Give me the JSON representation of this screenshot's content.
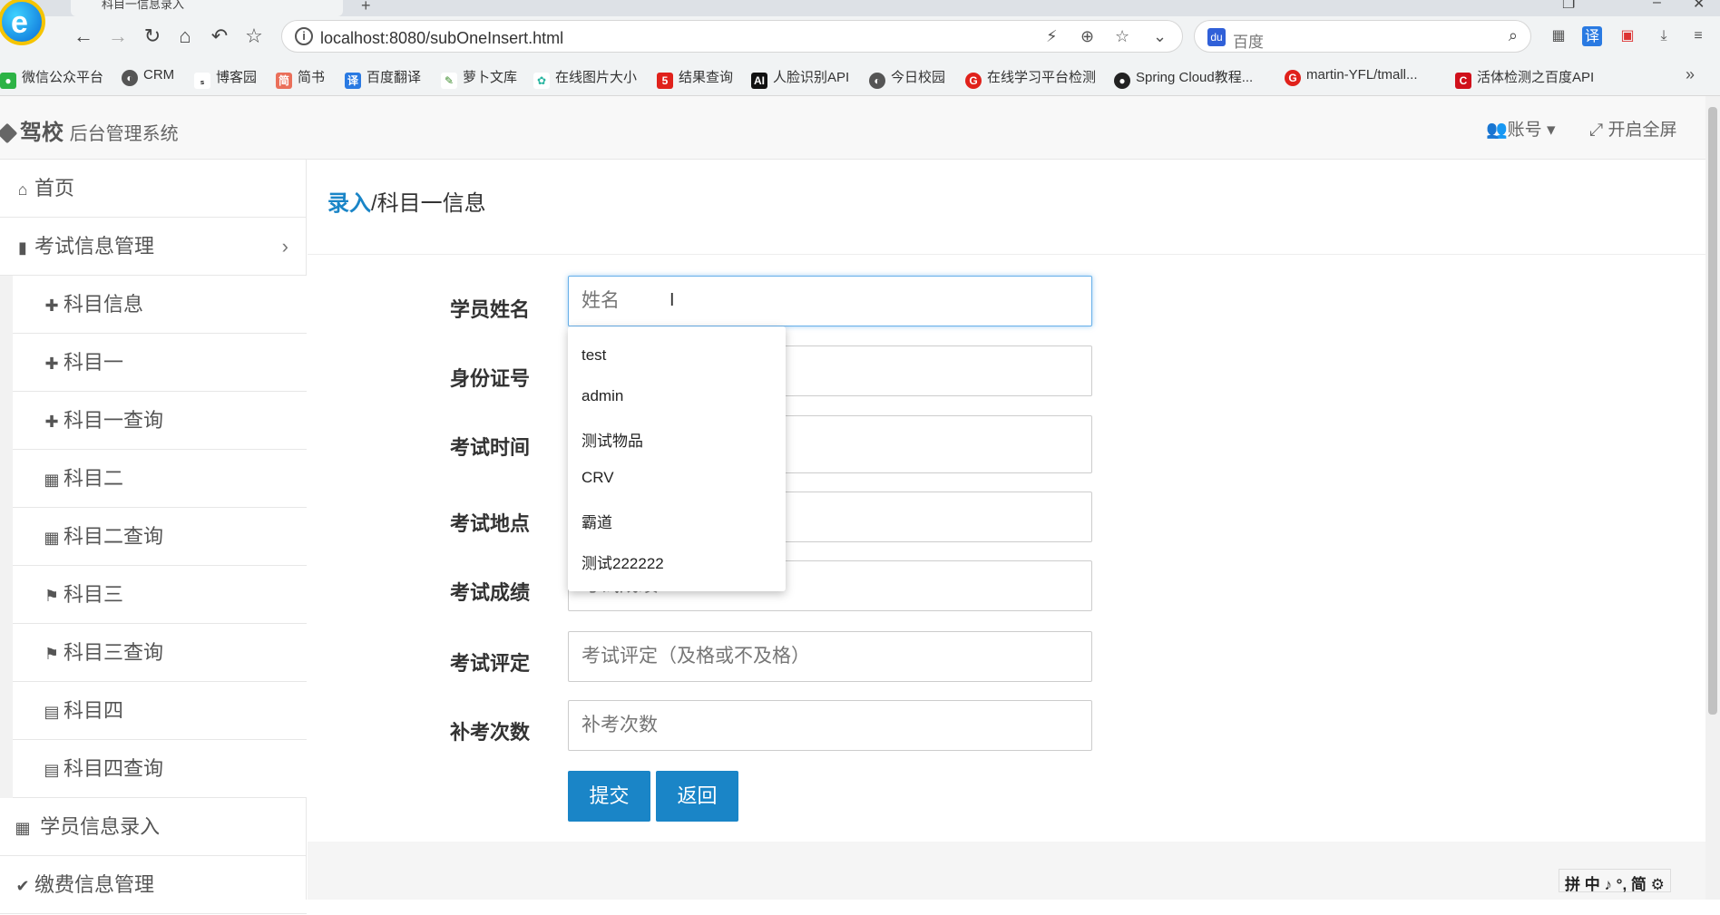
{
  "browser": {
    "tab_title": "科目一信息录入",
    "address": "localhost:8080/subOneInsert.html",
    "search_placeholder": "百度",
    "bookmarks": [
      {
        "label": "微信公众平台",
        "color": "#2db346"
      },
      {
        "label": "CRM",
        "color": "#555555"
      },
      {
        "label": "博客园",
        "color": "#555555"
      },
      {
        "label": "简书",
        "color": "#ea6f5a"
      },
      {
        "label": "百度翻译",
        "color": "#2a7ae2"
      },
      {
        "label": "萝卜文库",
        "color": "#3a8a2a"
      },
      {
        "label": "在线图片大小",
        "color": "#28b5a0"
      },
      {
        "label": "结果查询",
        "color": "#e0211b"
      },
      {
        "label": "人脸识别API",
        "color": "#111111"
      },
      {
        "label": "今日校园",
        "color": "#555555"
      },
      {
        "label": "在线学习平台检测",
        "color": "#e0211b"
      },
      {
        "label": "Spring Cloud教程...",
        "color": "#222222"
      },
      {
        "label": "martin-YFL/tmall...",
        "color": "#e0211b"
      },
      {
        "label": "活体检测之百度API",
        "color": "#d0101b"
      }
    ]
  },
  "header": {
    "brand": "驾校",
    "subtitle": "后台管理系统",
    "account": "账号",
    "fullscreen": "开启全屏"
  },
  "sidebar": {
    "items": [
      {
        "label": "首页",
        "icon": "home-icon",
        "glyph": "⌂"
      },
      {
        "label": "考试信息管理",
        "icon": "file-icon",
        "glyph": "▮"
      },
      {
        "label": "科目信息",
        "icon": "puzzle-icon",
        "glyph": "✚"
      },
      {
        "label": "科目一",
        "icon": "puzzle-icon",
        "glyph": "✚"
      },
      {
        "label": "科目一查询",
        "icon": "puzzle-icon",
        "glyph": "✚"
      },
      {
        "label": "科目二",
        "icon": "grid-icon",
        "glyph": "▦"
      },
      {
        "label": "科目二查询",
        "icon": "grid-icon",
        "glyph": "▦"
      },
      {
        "label": "科目三",
        "icon": "flag-icon",
        "glyph": "⚑"
      },
      {
        "label": "科目三查询",
        "icon": "flag-icon",
        "glyph": "⚑"
      },
      {
        "label": "科目四",
        "icon": "calendar-icon",
        "glyph": "▤"
      },
      {
        "label": "科目四查询",
        "icon": "calendar-icon",
        "glyph": "▤"
      },
      {
        "label": "学员信息录入",
        "icon": "table-icon",
        "glyph": "▦"
      },
      {
        "label": "缴费信息管理",
        "icon": "check-icon",
        "glyph": "✔"
      }
    ]
  },
  "page": {
    "title_link": "录入",
    "title_rest": "/科目一信息"
  },
  "form": {
    "fields": [
      {
        "label": "学员姓名",
        "placeholder": "姓名"
      },
      {
        "label": "身份证号",
        "placeholder": "身份证号"
      },
      {
        "label": "考试时间",
        "placeholder": "考试时间"
      },
      {
        "label": "考试地点",
        "placeholder": "考试地点"
      },
      {
        "label": "考试成绩",
        "placeholder": "考试成绩"
      },
      {
        "label": "考试评定",
        "placeholder": "考试评定（及格或不及格）"
      },
      {
        "label": "补考次数",
        "placeholder": "补考次数"
      }
    ],
    "submit": "提交",
    "back": "返回"
  },
  "autocomplete": [
    "test",
    "admin",
    "测试物品",
    "CRV",
    "霸道",
    "测试222222"
  ],
  "ime": "拼 中 ♪ °, 简 ⚙"
}
